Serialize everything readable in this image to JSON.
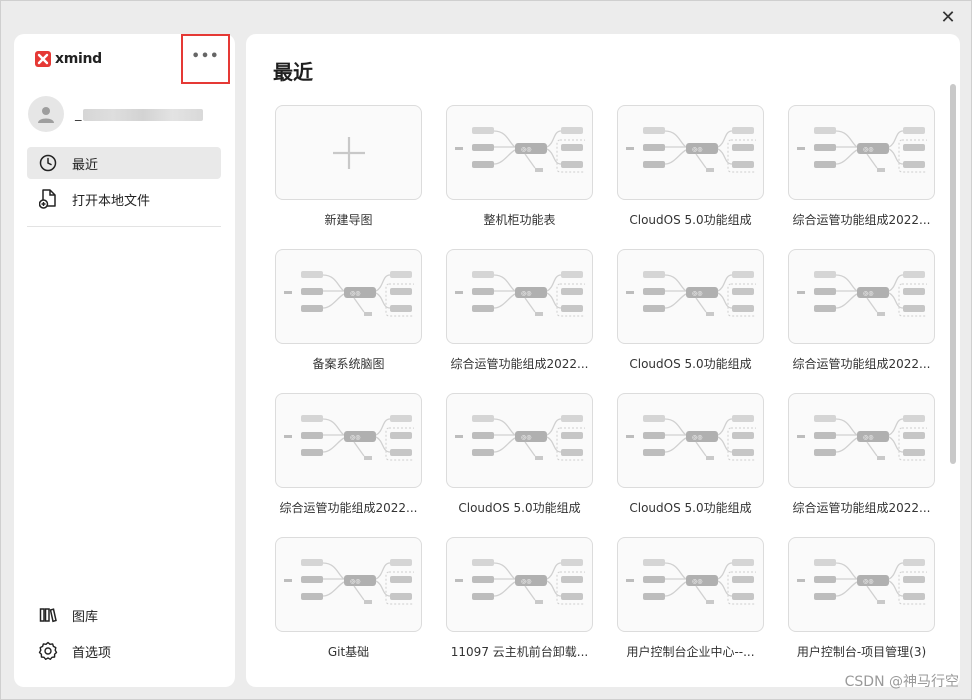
{
  "window": {
    "close_glyph": "✕"
  },
  "brand": {
    "name": "xmind",
    "logo_color": "#e53935"
  },
  "account": {
    "name": "_"
  },
  "nav": [
    {
      "label": "最近",
      "icon": "clock-icon"
    },
    {
      "label": "打开本地文件",
      "icon": "file-open-icon"
    }
  ],
  "bottom_nav": [
    {
      "label": "图库",
      "icon": "library-icon"
    },
    {
      "label": "首选项",
      "icon": "gear-icon"
    }
  ],
  "main": {
    "title": "最近",
    "items": [
      {
        "title": "新建导图",
        "type": "new"
      },
      {
        "title": "整机柜功能表",
        "type": "map"
      },
      {
        "title": "CloudOS 5.0功能组成",
        "type": "map"
      },
      {
        "title": "综合运管功能组成2022...",
        "type": "map"
      },
      {
        "title": "备案系统脑图",
        "type": "map"
      },
      {
        "title": "综合运管功能组成2022...",
        "type": "map"
      },
      {
        "title": "CloudOS 5.0功能组成",
        "type": "map"
      },
      {
        "title": "综合运管功能组成2022...",
        "type": "map"
      },
      {
        "title": "综合运管功能组成2022...",
        "type": "map"
      },
      {
        "title": "CloudOS 5.0功能组成",
        "type": "map"
      },
      {
        "title": "CloudOS 5.0功能组成",
        "type": "map"
      },
      {
        "title": "综合运管功能组成2022...",
        "type": "map"
      },
      {
        "title": "Git基础",
        "type": "map"
      },
      {
        "title": "11097 云主机前台卸载...",
        "type": "map"
      },
      {
        "title": "用户控制台企业中心--...",
        "type": "map"
      },
      {
        "title": "用户控制台-项目管理(3)",
        "type": "map"
      }
    ]
  },
  "watermark": "CSDN @神马行空"
}
